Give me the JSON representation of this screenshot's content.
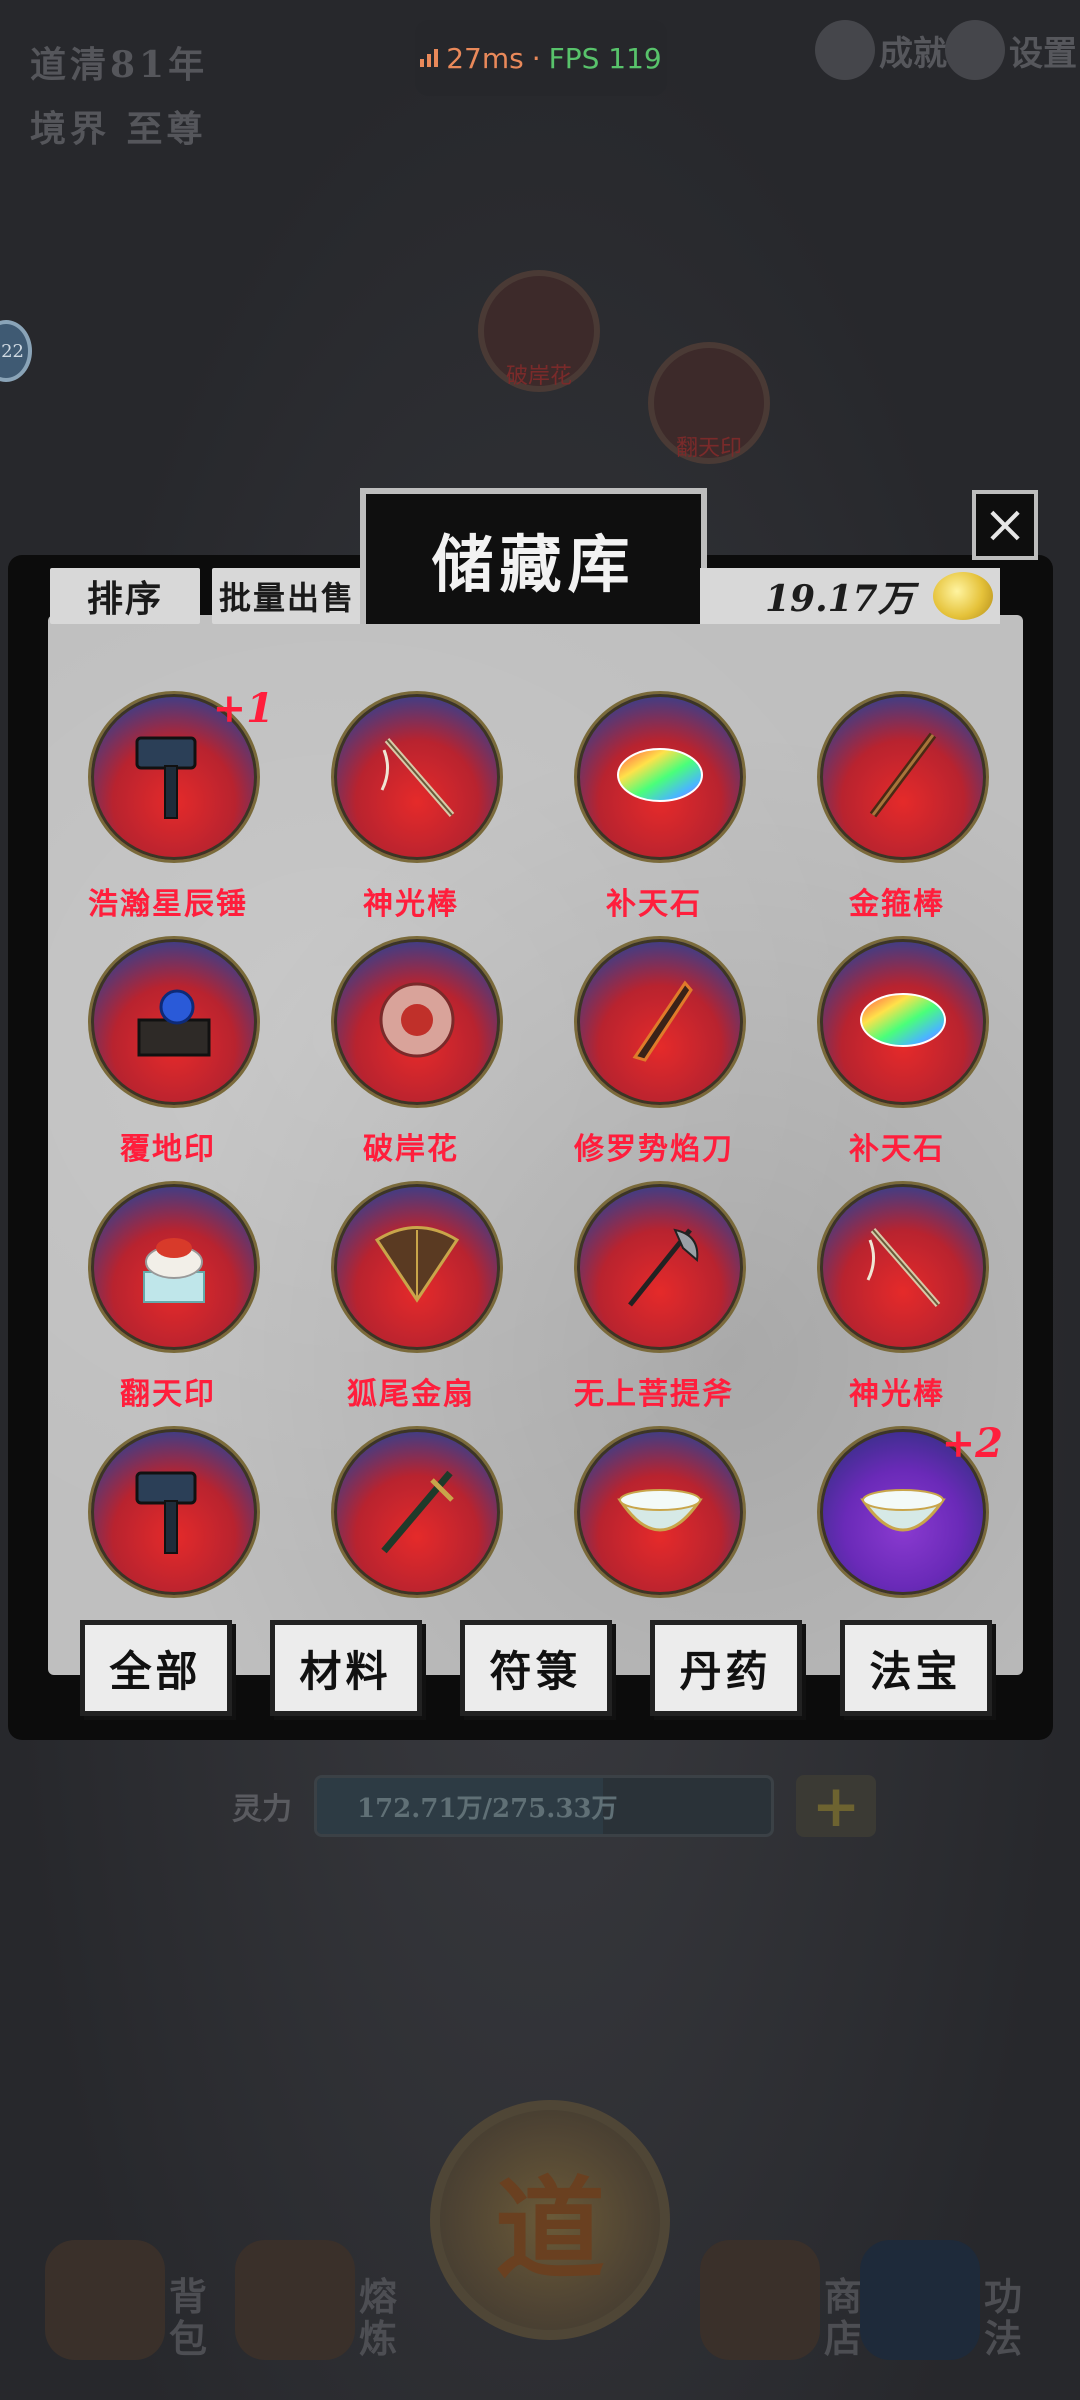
{
  "status": {
    "ping": "27ms",
    "separator": "·",
    "fps": "FPS 119"
  },
  "background": {
    "player_name": "道清81年",
    "realm": "境界 至尊",
    "achievement_label": "成就",
    "settings_label": "设置",
    "side_badge": "22",
    "orbs": [
      "破岸花",
      "翻天印"
    ],
    "mana_label": "灵力",
    "mana_value": "172.71万/275.33万",
    "mana_fill": 0.63,
    "nav": {
      "bag": "背包",
      "refine": "熔炼",
      "shop": "商店",
      "skills": "功法",
      "dao": "道"
    }
  },
  "dialog": {
    "title": "储藏库",
    "close_symbol": "×",
    "sort_label": "排序",
    "batch_sell_label": "批量出售",
    "currency_value": "19.17万",
    "items": [
      {
        "name": "浩瀚星辰锤",
        "icon": "hammer-icon",
        "badge": "+1"
      },
      {
        "name": "神光棒",
        "icon": "staff-icon",
        "badge": ""
      },
      {
        "name": "补天石",
        "icon": "rainbow-stone-icon",
        "badge": ""
      },
      {
        "name": "金箍棒",
        "icon": "golden-rod-icon",
        "badge": ""
      },
      {
        "name": "覆地印",
        "icon": "seal-box-icon",
        "badge": ""
      },
      {
        "name": "破岸花",
        "icon": "flower-orb-icon",
        "badge": ""
      },
      {
        "name": "修罗势焰刀",
        "icon": "flame-blade-icon",
        "badge": ""
      },
      {
        "name": "补天石",
        "icon": "rainbow-stone-icon",
        "badge": ""
      },
      {
        "name": "翻天印",
        "icon": "jade-seal-icon",
        "badge": ""
      },
      {
        "name": "狐尾金扇",
        "icon": "fan-icon",
        "badge": ""
      },
      {
        "name": "无上菩提斧",
        "icon": "axe-icon",
        "badge": ""
      },
      {
        "name": "神光棒",
        "icon": "staff-icon",
        "badge": ""
      },
      {
        "name": "",
        "icon": "hammer-icon",
        "badge": ""
      },
      {
        "name": "",
        "icon": "sword-icon",
        "badge": ""
      },
      {
        "name": "",
        "icon": "bowl-icon",
        "badge": ""
      },
      {
        "name": "",
        "icon": "bowl-icon",
        "badge": "+2"
      }
    ],
    "tabs": [
      "全部",
      "材料",
      "符箓",
      "丹药",
      "法宝"
    ]
  }
}
